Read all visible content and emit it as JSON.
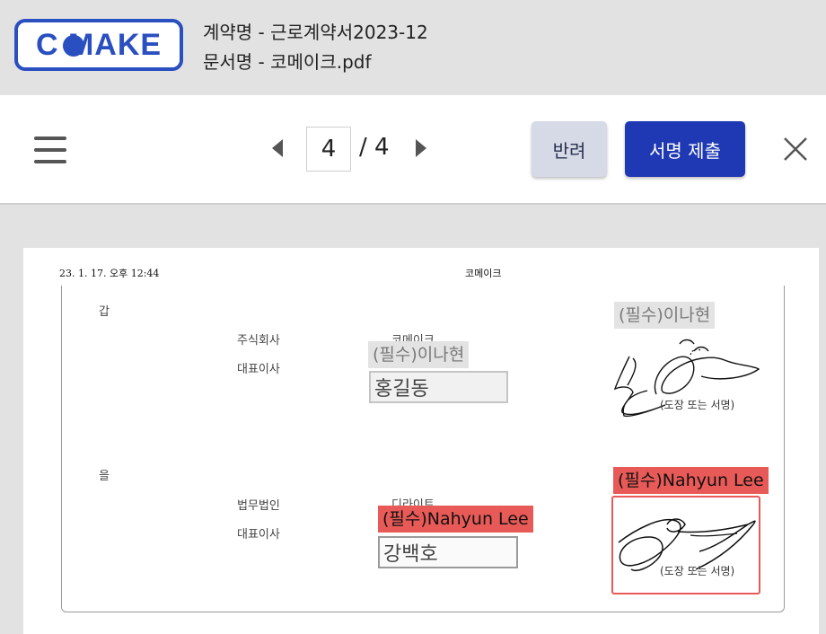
{
  "header": {
    "logo_text": "C MAKE",
    "contract_name": "계약명 - 근로계약서2023-12",
    "document_name": "문서명 - 코메이크.pdf"
  },
  "toolbar": {
    "current_page": "4",
    "total_pages": "/ 4",
    "reject_label": "반려",
    "submit_label": "서명 제출"
  },
  "document": {
    "print_header_left": "23. 1. 17. 오후 12:44",
    "print_header_center": "코메이크",
    "party_a": {
      "label": "갑",
      "company_type": "주식회사",
      "representative_label": "대표이사",
      "company_name": "코메이크",
      "name_field_label": "(필수)이나현",
      "name_value": "홍길동",
      "signature_label": "(필수)이나현",
      "signature_caption": "(도장 또는 서명)"
    },
    "party_b": {
      "label": "을",
      "company_type": "법무법인",
      "representative_label": "대표이사",
      "company_name": "디라이트",
      "name_field_label": "(필수)Nahyun Lee",
      "name_value": "강백호",
      "signature_label": "(필수)Nahyun Lee",
      "signature_caption": "(도장 또는 서명)"
    }
  },
  "colors": {
    "brand": "#2a4fc0",
    "submit": "#1f38b3",
    "reject": "#d6d9e6",
    "required_active": "#e85a57",
    "required_inactive": "#e3e3e3"
  },
  "icons": [
    "menu-icon",
    "prev-page-icon",
    "next-page-icon",
    "close-icon"
  ]
}
